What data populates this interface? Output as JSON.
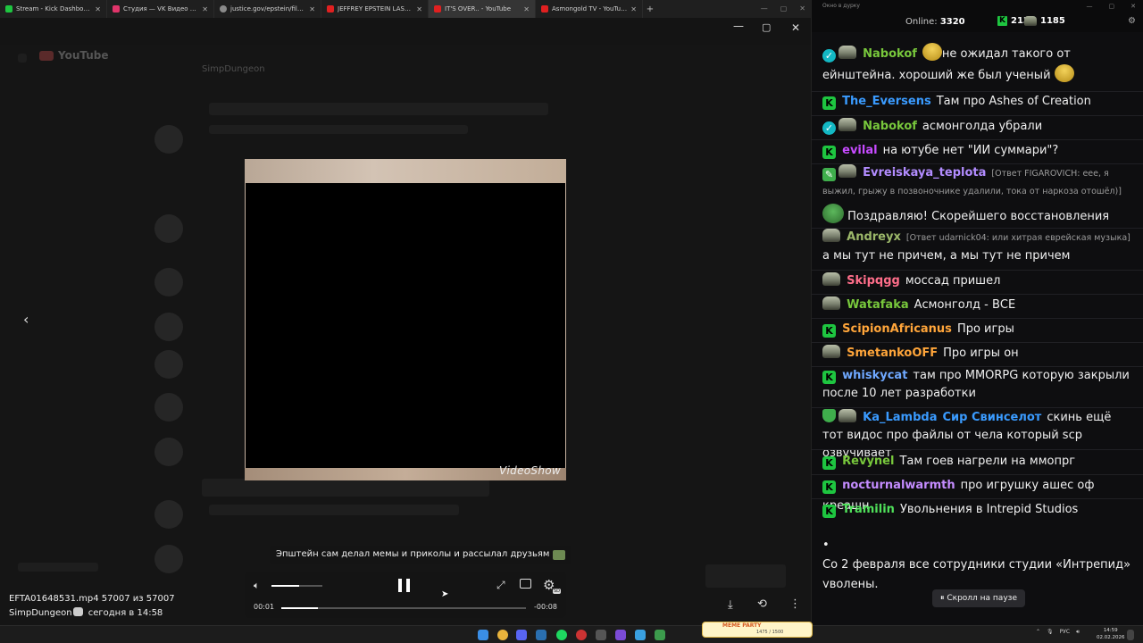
{
  "browser_tabs": [
    {
      "title": "Stream - Kick Dashboard",
      "favicon_color": "#1ec540"
    },
    {
      "title": "Студия — VK Видео Live",
      "favicon_color": "#e0346a"
    },
    {
      "title": "justice.gov/epstein/files/DataSe",
      "favicon_color": "#8a8a8a"
    },
    {
      "title": "JEFFREY EPSTEIN LAST INTERVI",
      "favicon_color": "#e02020"
    },
    {
      "title": "IT'S OVER.. - YouTube",
      "favicon_color": "#e02020"
    },
    {
      "title": "Asmongold TV - YouTube",
      "favicon_color": "#e02020"
    }
  ],
  "youtube_bg": {
    "logo": "YouTube",
    "channel_name": "SimpDungeon"
  },
  "viewer": {
    "watermark": "VideoShow",
    "caption": "Эпштейн сам делал мемы и приколы и рассылал друзьям",
    "time_current": "00:01",
    "time_remaining": "-00:08",
    "volume_level": 0.55,
    "progress_level": 0.15,
    "settings_badge": "SD",
    "filename": "EFTA01648531.mp4 57007 из 57007",
    "author": "SimpDungeon",
    "posted": "сегодня в 14:58"
  },
  "chat": {
    "window_title": "Окно в дурку",
    "online_label": "Online:",
    "online_count": "3320",
    "kick_count": "2135",
    "yt_count": "1185",
    "messages": [
      {
        "id": "m1",
        "badges": [
          "verified",
          "helmet"
        ],
        "user": "Nabokof",
        "color": "#78c83c",
        "text": "не ожидал такого от ейнштейна. хороший же был ученый",
        "reply": ""
      },
      {
        "id": "m2",
        "badges": [
          "kick"
        ],
        "user": "The_Eversens",
        "color": "#3a9bff",
        "text": "Там про Ashes of Creation",
        "reply": ""
      },
      {
        "id": "m3",
        "badges": [
          "verified",
          "helmet"
        ],
        "user": "Nabokof",
        "color": "#78c83c",
        "text": "асмонголда убрали",
        "reply": ""
      },
      {
        "id": "m4",
        "badges": [
          "kick"
        ],
        "user": "evilal",
        "color": "#c64bff",
        "text": "на ютубе нет \"ИИ суммари\"?",
        "reply": ""
      },
      {
        "id": "m5",
        "badges": [
          "mod",
          "helmet"
        ],
        "user": "Evreiskaya_teplota",
        "color": "#b28cff",
        "text": "Поздравляю! Скорейшего восстановления",
        "reply": "[Ответ FIGAROVICH: еее, я выжил, грыжу в позвоночнике удалили, тока от наркоза отошёл)]"
      },
      {
        "id": "m6",
        "badges": [
          "helmet"
        ],
        "user": "Andreyx",
        "color": "#9cb86a",
        "text": "а мы тут не причем, а мы тут не причем",
        "reply": "[Ответ udarnick04: или хитрая еврейская музыка]"
      },
      {
        "id": "m7",
        "badges": [
          "helmet"
        ],
        "user": "Skipqgg",
        "color": "#ff6e8a",
        "text": "моссад пришел",
        "reply": ""
      },
      {
        "id": "m8",
        "badges": [
          "helmet"
        ],
        "user": "Watafaka",
        "color": "#78c83c",
        "text": "Асмонголд - ВСЕ",
        "reply": ""
      },
      {
        "id": "m9",
        "badges": [
          "kick"
        ],
        "user": "ScipionAfricanus",
        "color": "#ffa53a",
        "text": "Про игры",
        "reply": ""
      },
      {
        "id": "m10",
        "badges": [
          "helmet"
        ],
        "user": "SmetankoOFF",
        "color": "#ffa53a",
        "text": "Про игры он",
        "reply": ""
      },
      {
        "id": "m11",
        "badges": [
          "kick"
        ],
        "user": "whiskycat",
        "color": "#6fa8ff",
        "text": "там про MMORPG которую закрыли после 10 лет разработки",
        "reply": ""
      },
      {
        "id": "m12",
        "badges": [
          "sub",
          "helmet"
        ],
        "user": "Ka_Lambda",
        "color": "#3a9bff",
        "text": "скинь ещё тот видос про файлы от чела который scp озвучивает",
        "reply": "",
        "mention": "Сир Свинселот"
      },
      {
        "id": "m13",
        "badges": [
          "kick"
        ],
        "user": "Revynel",
        "color": "#78c83c",
        "text": "Там гоев нагрели на ммопрг",
        "reply": ""
      },
      {
        "id": "m14",
        "badges": [
          "kick"
        ],
        "user": "nocturnalwarmth",
        "color": "#c48cff",
        "text": "про игрушку ашес оф креашн",
        "reply": ""
      },
      {
        "id": "m15",
        "badges": [
          "kick"
        ],
        "user": "Tramilin",
        "color": "#4fe05a",
        "text": "Увольнения в Intrepid Studios",
        "reply": ""
      }
    ],
    "final_bullet": "•",
    "final_text": "Со 2 февраля все сотрудники студии «Интрепид» уволены.",
    "pause_pill": "⏸ Скролл на паузе"
  },
  "taskbar": {
    "widget_label": "MEME PARTY",
    "widget_count": "1475 / 1500",
    "lang": "РУС",
    "time": "14:59",
    "date": "02.02.2026"
  }
}
